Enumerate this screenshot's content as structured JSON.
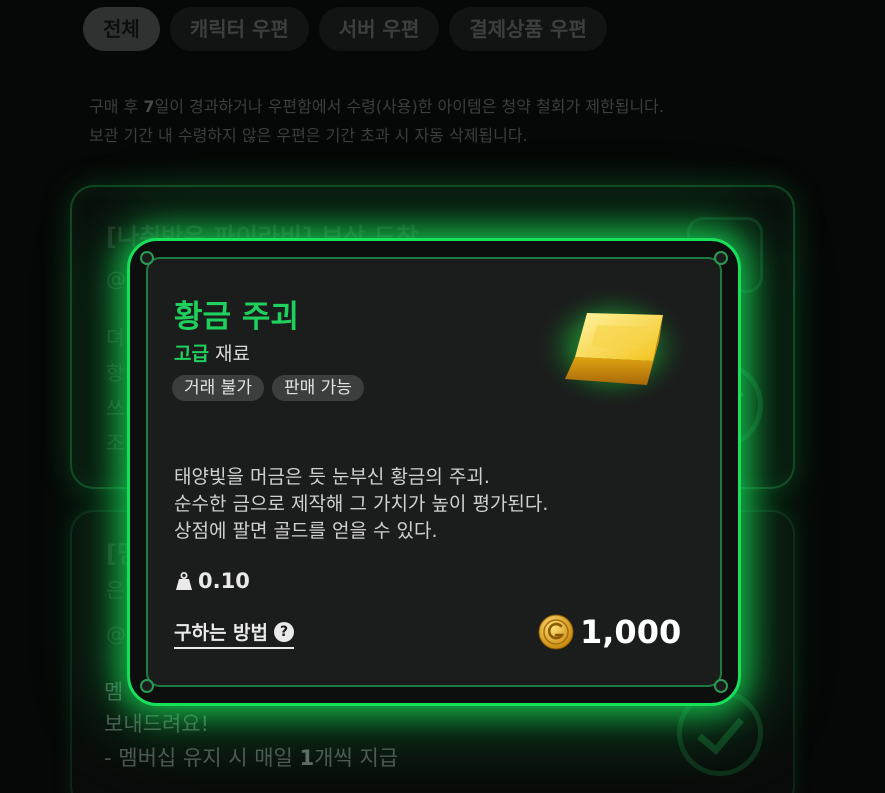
{
  "tabs": [
    {
      "label": "전체",
      "active": true
    },
    {
      "label": "캐릭터 우편",
      "active": false
    },
    {
      "label": "서버 우편",
      "active": false
    },
    {
      "label": "결제상품 우편",
      "active": false
    }
  ],
  "notice": {
    "line1_prefix": "구매 후 ",
    "line1_days": "7",
    "line1_suffix": "일이 경과하거나 우편함에서 수령(사용)한 아이템은 청약 철회가 제한됩니다.",
    "line2": "보관 기간 내 수령하지 않은 우편은 기간 초과 시 자동 삭제됩니다."
  },
  "background_mail": {
    "card1_title": "[나취반은 파이라비] 보상 도착",
    "card1_lines": [
      "@",
      "뎌",
      "항",
      "쓰",
      "조"
    ],
    "card2_title": "[멤",
    "card2_lines": [
      "은",
      "@"
    ],
    "bottom_lines": {
      "line1": "멤",
      "line2": "보내드려요!",
      "line3_prefix": "- 멤버십 유지 시 매일 ",
      "line3_count": "1",
      "line3_suffix": "개씩 지급"
    }
  },
  "popup": {
    "item_name": "황금 주괴",
    "grade": "고급",
    "item_type": "재료",
    "tags": [
      "거래 불가",
      "판매 가능"
    ],
    "description": [
      "태양빛을 머금은 듯 눈부신 황금의 주괴.",
      "순수한 금으로 제작해 그 가치가 높이 평가된다.",
      "상점에 팔면 골드를 얻을 수 있다."
    ],
    "weight": "0.10",
    "how_to_get_label": "구하는 방법",
    "help_icon_glyph": "?",
    "price": "1,000",
    "icons": {
      "item": "gold-bar-icon",
      "weight": "weight-icon",
      "help": "question-mark-icon",
      "currency": "gold-coin-icon"
    },
    "colors": {
      "accent": "#1fd15c",
      "glow": "#18e05a",
      "panel": "#1b1d1c"
    }
  }
}
